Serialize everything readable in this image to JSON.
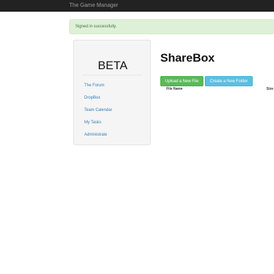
{
  "navbar": {
    "brand": "The Game Manager"
  },
  "alert": {
    "message": "Signed in successfully."
  },
  "sidebar": {
    "logo": "BETA",
    "links": [
      "The Forum",
      "DropBox",
      "Team Calendar",
      "My Tasks",
      "Administrate"
    ]
  },
  "main": {
    "title": "ShareBox",
    "upload_label": "Upload a New File",
    "new_folder_label": "Create a New Folder",
    "table": {
      "columns": [
        "File Name",
        "Size"
      ]
    }
  },
  "colors": {
    "navbar": "#222222",
    "alert_bg": "#dff0d8",
    "alert_text": "#3c763d",
    "link": "#337ab7",
    "upload_button": "#5cb85c",
    "folder_button": "#5bc0de"
  }
}
